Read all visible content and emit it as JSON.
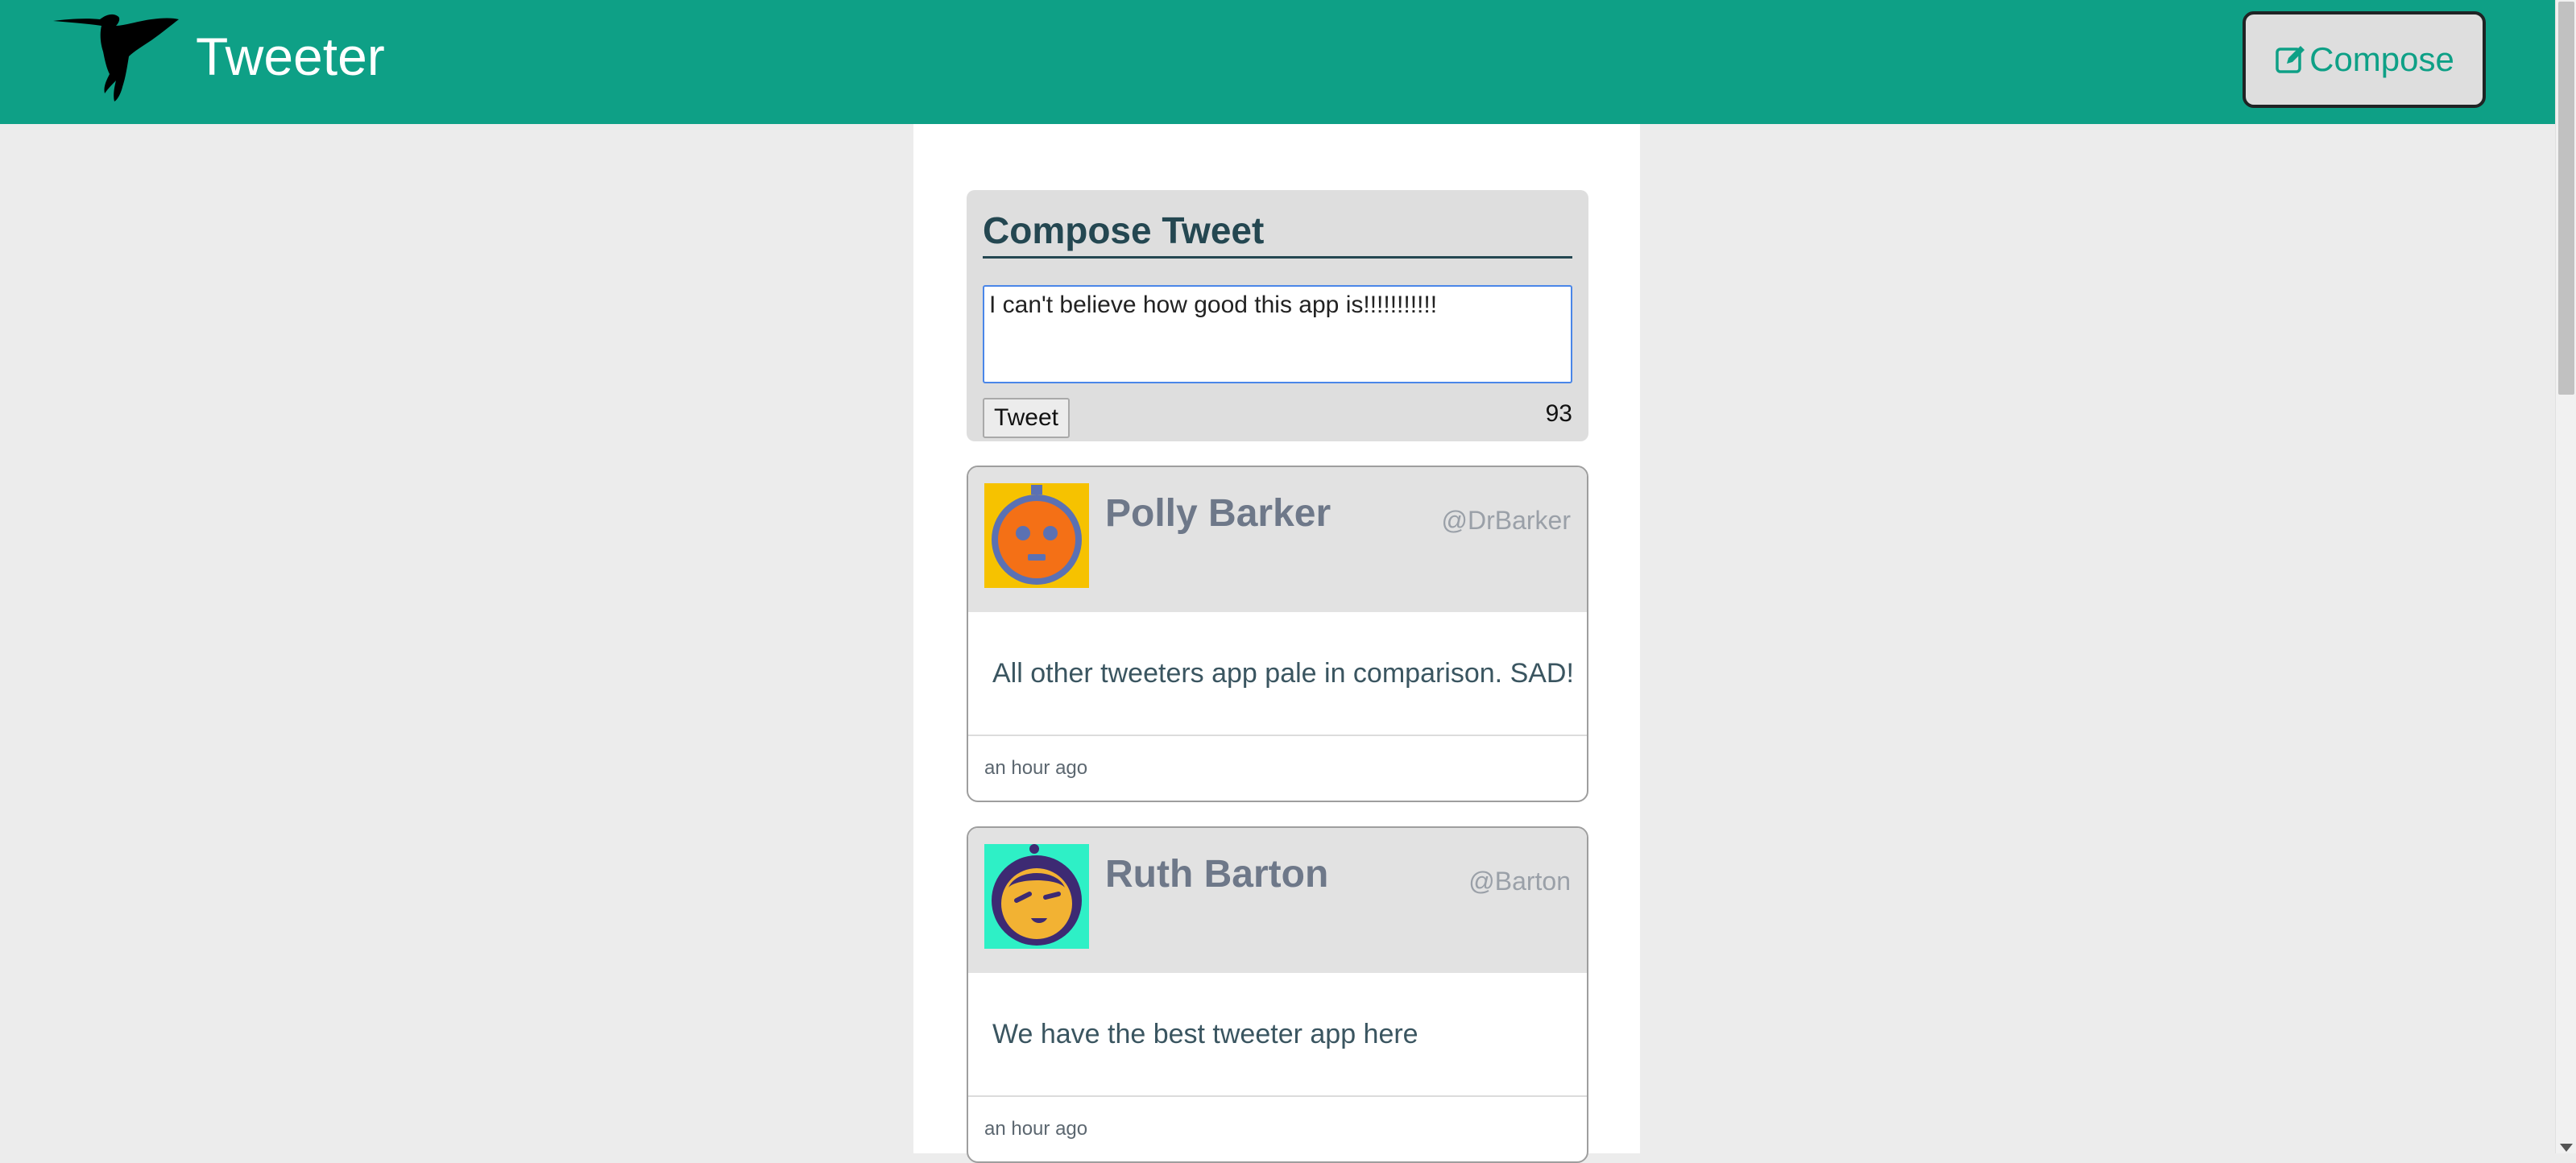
{
  "header": {
    "brand_title": "Tweeter",
    "brand_logo_icon": "hummingbird-icon",
    "compose_label": "Compose",
    "compose_icon": "pencil-square-icon",
    "background_color": "#0ea086"
  },
  "composer": {
    "heading": "Compose Tweet",
    "text_value": "I can't believe how good this app is!!!!!!!!!!!",
    "tweet_button_label": "Tweet",
    "char_counter": "93"
  },
  "tweets": [
    {
      "name": "Polly Barker",
      "handle": "@DrBarker",
      "content": "All other tweeters app pale in comparison. SAD!",
      "time": "an hour ago",
      "avatar_icon": "robot-avatar-icon"
    },
    {
      "name": "Ruth Barton",
      "handle": "@Barton",
      "content": "We have the best tweeter app here",
      "time": "an hour ago",
      "avatar_icon": "winking-face-avatar-icon"
    }
  ]
}
